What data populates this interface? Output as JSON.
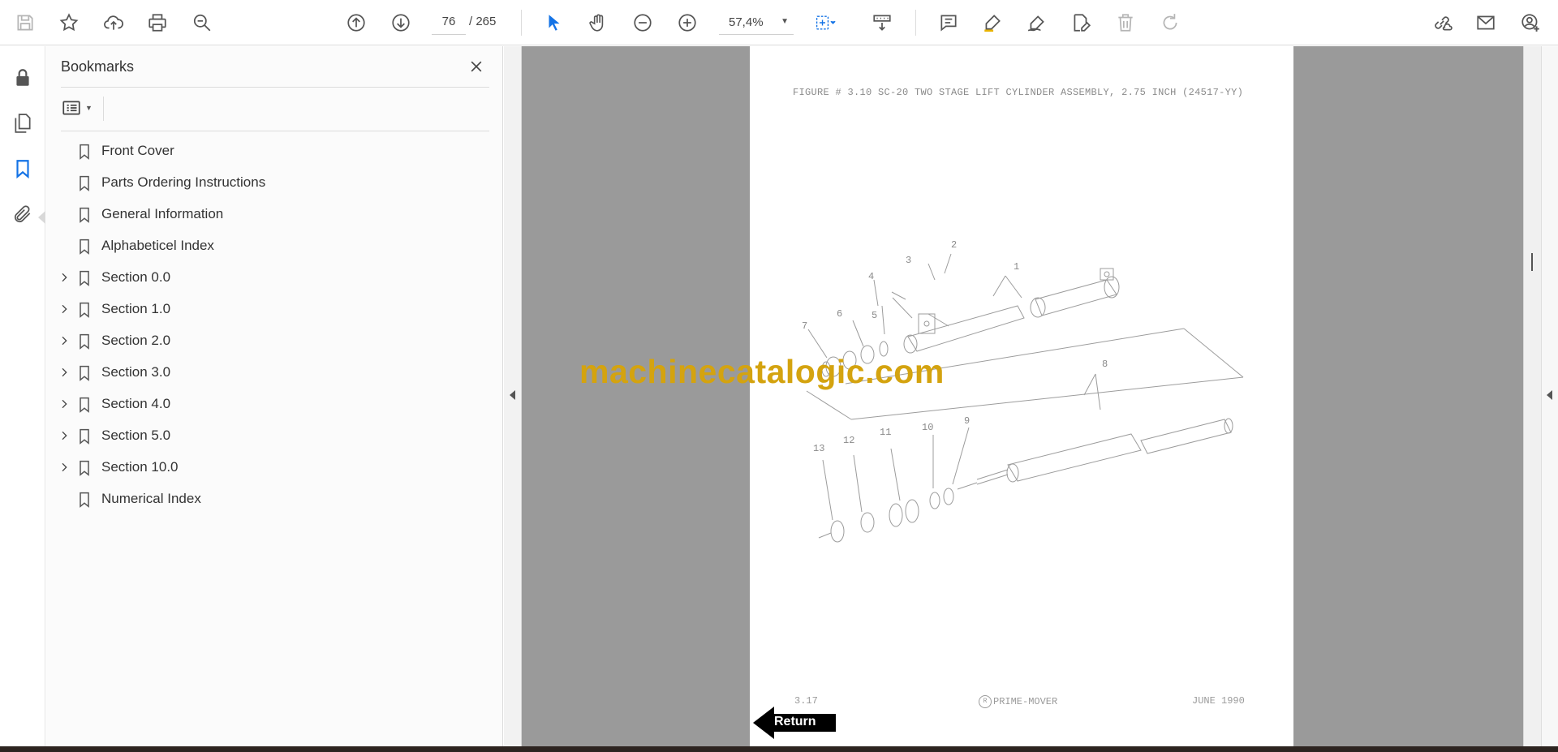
{
  "toolbar": {
    "page_current": "76",
    "page_total": "/ 265",
    "zoom": "57,4%",
    "icons": [
      "save-icon",
      "bookmark-star-icon",
      "upload-icon",
      "print-icon",
      "find-icon",
      "page-up-icon",
      "page-down-icon",
      "select-arrow-icon",
      "hand-icon",
      "zoom-out-icon",
      "zoom-in-icon",
      "marquee-zoom-icon",
      "scroll-mode-icon",
      "comment-icon",
      "highlight-icon",
      "draw-icon",
      "edit-text-icon",
      "delete-icon",
      "redo-icon",
      "share-link-icon",
      "email-icon",
      "sign-in-icon"
    ],
    "accent": "#1473e6"
  },
  "rail": {
    "icons": [
      "lock-icon",
      "pages-icon",
      "bookmarks-icon",
      "attachments-icon"
    ]
  },
  "bookmarks": {
    "title": "Bookmarks",
    "items": [
      {
        "label": "Front Cover",
        "expandable": false
      },
      {
        "label": "Parts Ordering Instructions",
        "expandable": false
      },
      {
        "label": "General Information",
        "expandable": false
      },
      {
        "label": "Alphabeticel Index",
        "expandable": false
      },
      {
        "label": "Section 0.0",
        "expandable": true
      },
      {
        "label": "Section 1.0",
        "expandable": true
      },
      {
        "label": "Section 2.0",
        "expandable": true
      },
      {
        "label": "Section 3.0",
        "expandable": true
      },
      {
        "label": "Section 4.0",
        "expandable": true
      },
      {
        "label": "Section 5.0",
        "expandable": true
      },
      {
        "label": "Section 10.0",
        "expandable": true
      },
      {
        "label": "Numerical Index",
        "expandable": false
      }
    ]
  },
  "document": {
    "figure_title": "FIGURE # 3.10 SC-20 TWO STAGE LIFT CYLINDER ASSEMBLY, 2.75 INCH (24517-YY)",
    "callouts": [
      "1",
      "2",
      "3",
      "4",
      "5",
      "6",
      "7",
      "8",
      "9",
      "10",
      "11",
      "12",
      "13"
    ],
    "footer_page": "3.17",
    "footer_brand_mark": "R",
    "footer_brand": "PRIME-MOVER",
    "footer_date": "JUNE 1990",
    "return_label": "Return",
    "watermark": "machinecatalogic.com"
  }
}
